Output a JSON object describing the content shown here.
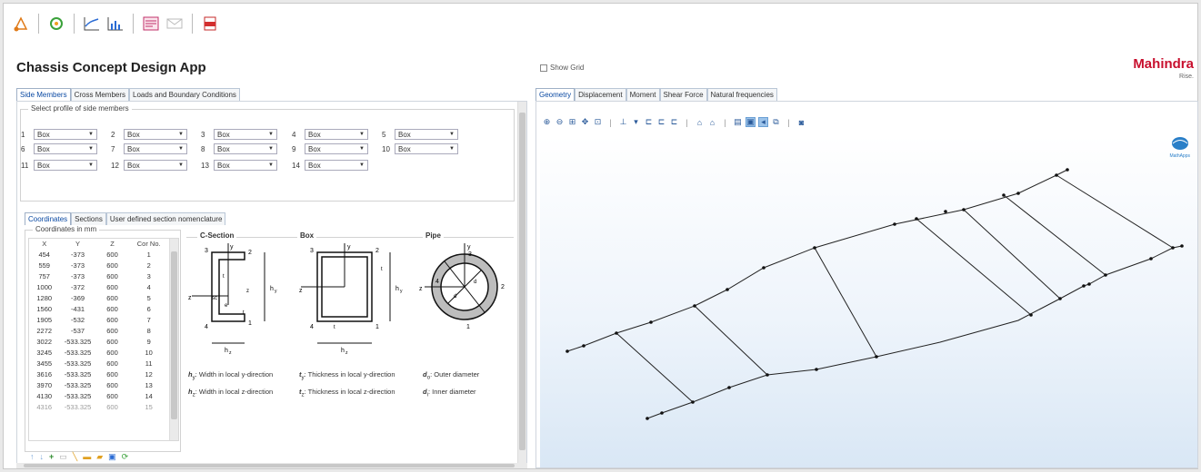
{
  "app": {
    "title": "Chassis Concept Design App",
    "show_grid_label": "Show Grid",
    "logo_text": "Mahindra",
    "logo_sub": "Rise."
  },
  "toolbar": {
    "icons": [
      "sketch-icon",
      "refresh-icon",
      "line-plot-icon",
      "bar-plot-icon",
      "report-icon",
      "email-icon",
      "pdf-icon"
    ]
  },
  "left_tabs": [
    "Side Members",
    "Cross Members",
    "Loads and Boundary Conditions"
  ],
  "side_members": {
    "group_title": "Select profile of side members",
    "profiles": [
      {
        "n": "1",
        "v": "Box"
      },
      {
        "n": "2",
        "v": "Box"
      },
      {
        "n": "3",
        "v": "Box"
      },
      {
        "n": "4",
        "v": "Box"
      },
      {
        "n": "5",
        "v": "Box"
      },
      {
        "n": "6",
        "v": "Box"
      },
      {
        "n": "7",
        "v": "Box"
      },
      {
        "n": "8",
        "v": "Box"
      },
      {
        "n": "9",
        "v": "Box"
      },
      {
        "n": "10",
        "v": "Box"
      },
      {
        "n": "11",
        "v": "Box"
      },
      {
        "n": "12",
        "v": "Box"
      },
      {
        "n": "13",
        "v": "Box"
      },
      {
        "n": "14",
        "v": "Box"
      }
    ]
  },
  "sub_tabs": [
    "Coordinates",
    "Sections",
    "User defined section nomenclature"
  ],
  "coordinates": {
    "group_title": "Coordinates in mm",
    "headers": [
      "X",
      "Y",
      "Z",
      "Cor No."
    ],
    "rows": [
      [
        "454",
        "-373",
        "600",
        "1"
      ],
      [
        "559",
        "-373",
        "600",
        "2"
      ],
      [
        "757",
        "-373",
        "600",
        "3"
      ],
      [
        "1000",
        "-372",
        "600",
        "4"
      ],
      [
        "1280",
        "-369",
        "600",
        "5"
      ],
      [
        "1560",
        "-431",
        "600",
        "6"
      ],
      [
        "1905",
        "-532",
        "600",
        "7"
      ],
      [
        "2272",
        "-537",
        "600",
        "8"
      ],
      [
        "3022",
        "-533.325",
        "600",
        "9"
      ],
      [
        "3245",
        "-533.325",
        "600",
        "10"
      ],
      [
        "3455",
        "-533.325",
        "600",
        "11"
      ],
      [
        "3616",
        "-533.325",
        "600",
        "12"
      ],
      [
        "3970",
        "-533.325",
        "600",
        "13"
      ],
      [
        "4130",
        "-533.325",
        "600",
        "14"
      ]
    ],
    "partial_row": [
      "4316",
      "-533.325",
      "600",
      "15"
    ]
  },
  "sections": {
    "c_section": "C-Section",
    "box": "Box",
    "pipe": "Pipe"
  },
  "legend": {
    "hy": "h",
    "hy_sub": "y",
    "hy_text": ": Width in local y-direction",
    "ty": "t",
    "ty_sub": "y",
    "ty_text": ": Thickness in local y-direction",
    "do": "d",
    "do_sub": "o",
    "do_text": ": Outer diameter",
    "hz": "h",
    "hz_sub": "z",
    "hz_text": ": Width in local z-direction",
    "tz": "t",
    "tz_sub": "z",
    "tz_text": ": Thickness in local z-direction",
    "di": "d",
    "di_sub": "i",
    "di_text": ": Inner diameter"
  },
  "right_tabs": [
    "Geometry",
    "Displacement",
    "Moment",
    "Shear Force",
    "Natural frequencies"
  ],
  "graphics_badge": "MathApps",
  "colors": {
    "accent": "#0b4aa3",
    "selected": "#9cc3ea",
    "brand": "#c8102e"
  }
}
